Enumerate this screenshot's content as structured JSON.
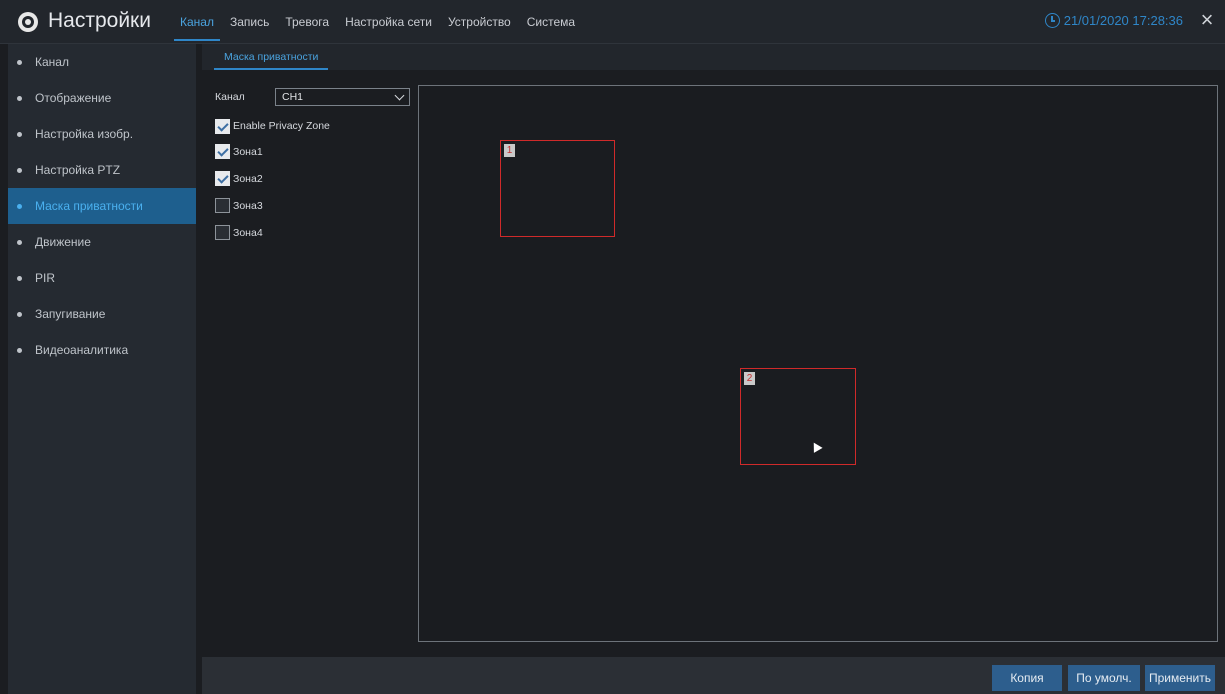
{
  "app": {
    "title": "Настройки"
  },
  "top_nav": {
    "tabs": [
      {
        "label": "Канал",
        "active": true
      },
      {
        "label": "Запись"
      },
      {
        "label": "Тревога"
      },
      {
        "label": "Настройка сети"
      },
      {
        "label": "Устройство"
      },
      {
        "label": "Система"
      }
    ]
  },
  "datetime": "21/01/2020 17:28:36",
  "close_icon": "×",
  "sidebar": {
    "items": [
      {
        "label": "Канал"
      },
      {
        "label": "Отображение"
      },
      {
        "label": "Настройка изобр."
      },
      {
        "label": "Настройка PTZ"
      },
      {
        "label": "Маска приватности",
        "active": true
      },
      {
        "label": "Движение"
      },
      {
        "label": "PIR"
      },
      {
        "label": "Запугивание"
      },
      {
        "label": "Видеоаналитика"
      }
    ]
  },
  "subtab": {
    "label": "Маска приватности"
  },
  "form": {
    "channel_label": "Канал",
    "channel_value": "CH1",
    "enable_label": "Enable Privacy Zone",
    "enable_checked": true,
    "zones": [
      {
        "label": "Зона1",
        "checked": true
      },
      {
        "label": "Зона2",
        "checked": true
      },
      {
        "label": "Зона3",
        "checked": false
      },
      {
        "label": "Зона4",
        "checked": false
      }
    ]
  },
  "preview": {
    "zones": [
      {
        "number": "1"
      },
      {
        "number": "2"
      }
    ]
  },
  "buttons": {
    "copy": "Копия",
    "default": "По умолч.",
    "apply": "Применить"
  },
  "colors": {
    "accent": "#2f86c8",
    "zone_border": "#d02a2a",
    "button_bg": "#2d5e8d"
  }
}
